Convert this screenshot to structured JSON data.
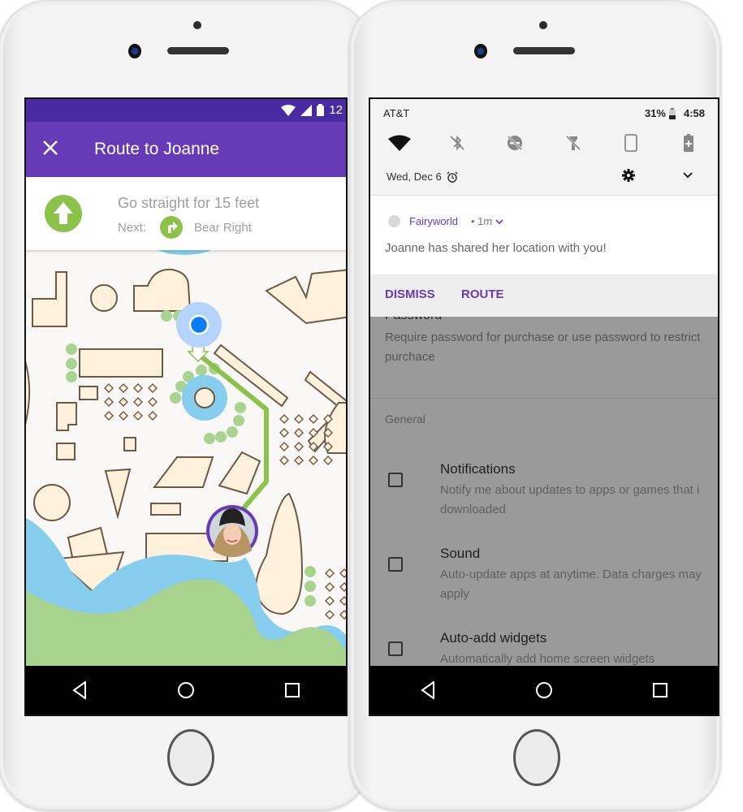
{
  "left_phone": {
    "status_bar": {
      "time_partial": "12"
    },
    "app_bar": {
      "close_icon": "close-icon",
      "title": "Route to Joanne"
    },
    "navigation": {
      "current_icon": "arrow-up-icon",
      "current_instruction": "Go straight for 15 feet",
      "next_label": "Next:",
      "next_icon": "bear-right-icon",
      "next_instruction": "Bear Right"
    },
    "map": {
      "user_marker": "current-location",
      "destination": "Joanne",
      "colors": {
        "route": "#8bc34a",
        "water": "#87ceee",
        "grass": "#a9d48f",
        "building": "#fff1dc",
        "outline": "#6b5a48",
        "marker": "#0a7cff",
        "accent": "#673ab7"
      }
    },
    "nav_bar": {
      "back": "back-icon",
      "home": "home-icon",
      "recents": "recents-icon"
    }
  },
  "right_phone": {
    "status_bar": {
      "carrier": "AT&T",
      "battery": "31%",
      "time": "4:58"
    },
    "quick_settings": [
      {
        "name": "wifi",
        "state": "on"
      },
      {
        "name": "bluetooth",
        "state": "off"
      },
      {
        "name": "do-not-disturb",
        "state": "off"
      },
      {
        "name": "flashlight",
        "state": "off"
      },
      {
        "name": "auto-rotate",
        "state": "off"
      },
      {
        "name": "battery-saver",
        "state": "off"
      }
    ],
    "date": "Wed, Dec 6",
    "notification": {
      "app_name": "Fairyworld",
      "time": "• 1m",
      "text": "Joanne has shared her location with you!",
      "actions": {
        "dismiss": "DISMISS",
        "route": "ROUTE"
      }
    },
    "settings": {
      "password_title": "Password",
      "password_desc": "Require password for purchase or use password to restrict purchace",
      "section_label": "General",
      "items": [
        {
          "title": "Notifications",
          "desc": "Notify me about updates to apps or games that i downloaded",
          "checked": false
        },
        {
          "title": "Sound",
          "desc": "Auto-update apps at anytime. Data charges may apply",
          "checked": false
        },
        {
          "title": "Auto-add widgets",
          "desc": "Automatically add home screen widgets",
          "checked": false
        }
      ]
    },
    "nav_bar": {
      "back": "back-icon",
      "home": "home-icon",
      "recents": "recents-icon"
    }
  }
}
